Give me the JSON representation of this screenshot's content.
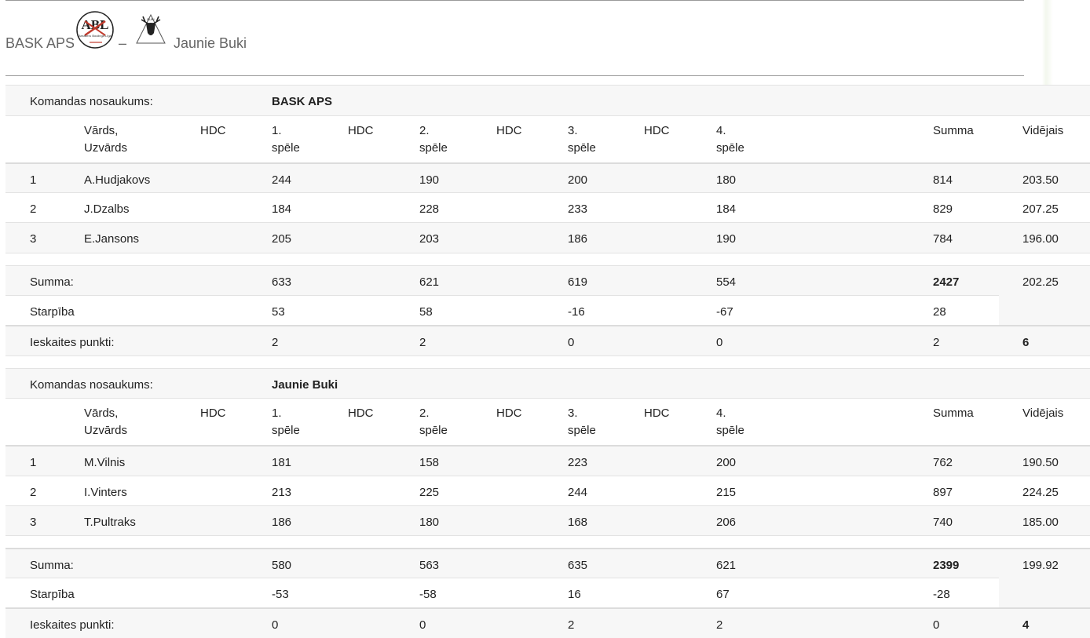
{
  "header": {
    "team1": "BASK APS",
    "separator": "–",
    "team2": "Jaunie Buki",
    "logo1_text": "ABL",
    "logo1_small": "Amatieru Boulinga Līga",
    "logo2_text": "BUKI"
  },
  "columns": {
    "player": "Vārds,",
    "player2": "Uzvārds",
    "hdc": "HDC",
    "g1a": "1.",
    "g1b": "spēle",
    "g2a": "2.",
    "g2b": "spēle",
    "g3a": "3.",
    "g3b": "spēle",
    "g4a": "4.",
    "g4b": "spēle",
    "sum": "Summa",
    "avg": "Vidējais"
  },
  "labels": {
    "team_name": "Komandas nosaukums:",
    "sum": "Summa:",
    "diff": "Starpība",
    "points": "Ieskaites punkti:"
  },
  "teams": [
    {
      "name": "BASK APS",
      "players": [
        {
          "no": "1",
          "name": "A.Hudjakovs",
          "g1": "244",
          "g2": "190",
          "g3": "200",
          "g4": "180",
          "sum": "814",
          "avg": "203.50"
        },
        {
          "no": "2",
          "name": "J.Dzalbs",
          "g1": "184",
          "g2": "228",
          "g3": "233",
          "g4": "184",
          "sum": "829",
          "avg": "207.25"
        },
        {
          "no": "3",
          "name": "E.Jansons",
          "g1": "205",
          "g2": "203",
          "g3": "186",
          "g4": "190",
          "sum": "784",
          "avg": "196.00"
        }
      ],
      "totals": {
        "g1": "633",
        "g2": "621",
        "g3": "619",
        "g4": "554",
        "sum": "2427",
        "avg": "202.25"
      },
      "diff": {
        "g1": "53",
        "g2": "58",
        "g3": "-16",
        "g4": "-67",
        "sum": "28"
      },
      "points": {
        "g1": "2",
        "g2": "2",
        "g3": "0",
        "g4": "0",
        "sum": "2",
        "total": "6"
      }
    },
    {
      "name": "Jaunie Buki",
      "players": [
        {
          "no": "1",
          "name": "M.Vilnis",
          "g1": "181",
          "g2": "158",
          "g3": "223",
          "g4": "200",
          "sum": "762",
          "avg": "190.50"
        },
        {
          "no": "2",
          "name": "I.Vinters",
          "g1": "213",
          "g2": "225",
          "g3": "244",
          "g4": "215",
          "sum": "897",
          "avg": "224.25"
        },
        {
          "no": "3",
          "name": "T.Pultraks",
          "g1": "186",
          "g2": "180",
          "g3": "168",
          "g4": "206",
          "sum": "740",
          "avg": "185.00"
        }
      ],
      "totals": {
        "g1": "580",
        "g2": "563",
        "g3": "635",
        "g4": "621",
        "sum": "2399",
        "avg": "199.92"
      },
      "diff": {
        "g1": "-53",
        "g2": "-58",
        "g3": "16",
        "g4": "67",
        "sum": "-28"
      },
      "points": {
        "g1": "0",
        "g2": "0",
        "g3": "2",
        "g4": "2",
        "sum": "0",
        "total": "4"
      }
    }
  ]
}
